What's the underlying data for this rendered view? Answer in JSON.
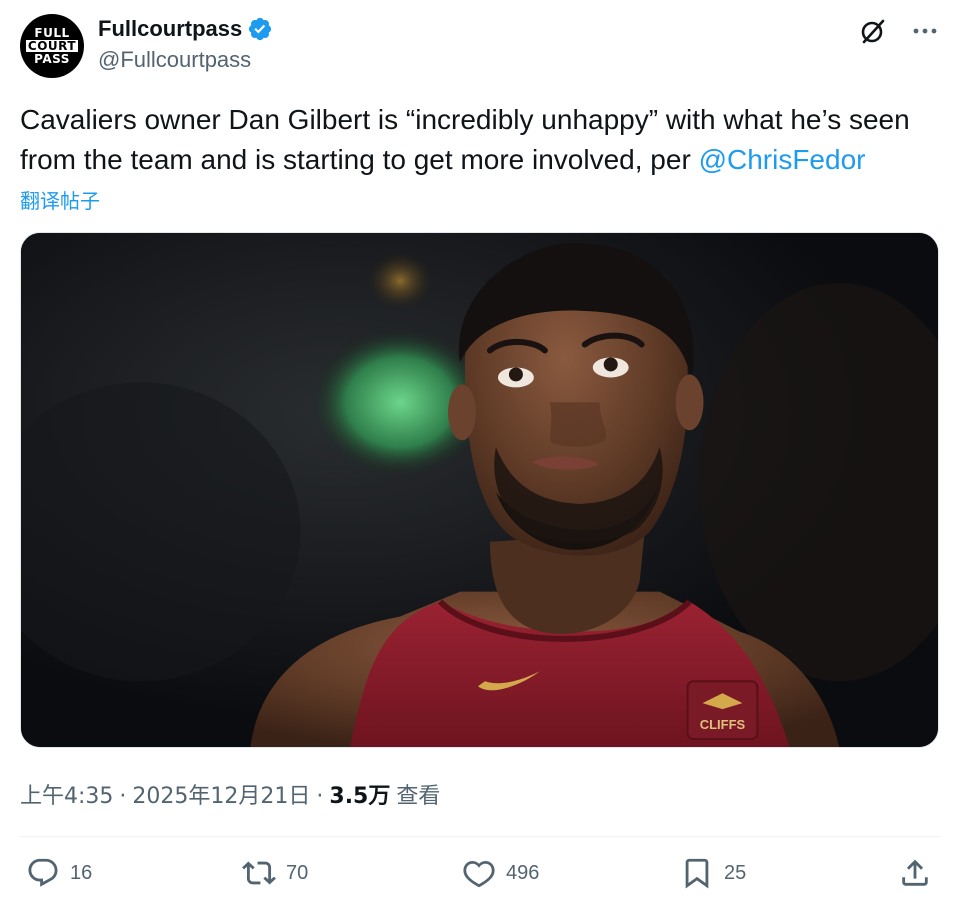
{
  "author": {
    "display_name": "Fullcourtpass",
    "handle": "@Fullcourtpass",
    "avatar_text": [
      "FULL",
      "COURT",
      "PASS"
    ],
    "verified": true
  },
  "post": {
    "text_before": "Cavaliers owner Dan Gilbert is “incredibly unhappy” with what he’s seen from the team and is starting to get more involved, per ",
    "mention": "@ChrisFedor",
    "translate_label": "翻译帖子"
  },
  "media": {
    "jersey_text": "CLIFFS"
  },
  "meta": {
    "time": "上午4:35",
    "separator1": "·",
    "date": "2025年12月21日",
    "separator2": "·",
    "views_count": "3.5万",
    "views_label": "查看"
  },
  "actions": {
    "reply_count": "16",
    "retweet_count": "70",
    "like_count": "496",
    "bookmark_count": "25"
  },
  "colors": {
    "accent": "#1d9bf0",
    "secondary_text": "#536471",
    "primary_text": "#0f1419",
    "jersey": "#8e1c2b"
  },
  "icons": {
    "verified": "verified-badge-icon",
    "grok": "grok-icon",
    "more": "more-icon",
    "reply": "reply-icon",
    "retweet": "retweet-icon",
    "like": "heart-icon",
    "bookmark": "bookmark-icon",
    "share": "share-icon"
  }
}
